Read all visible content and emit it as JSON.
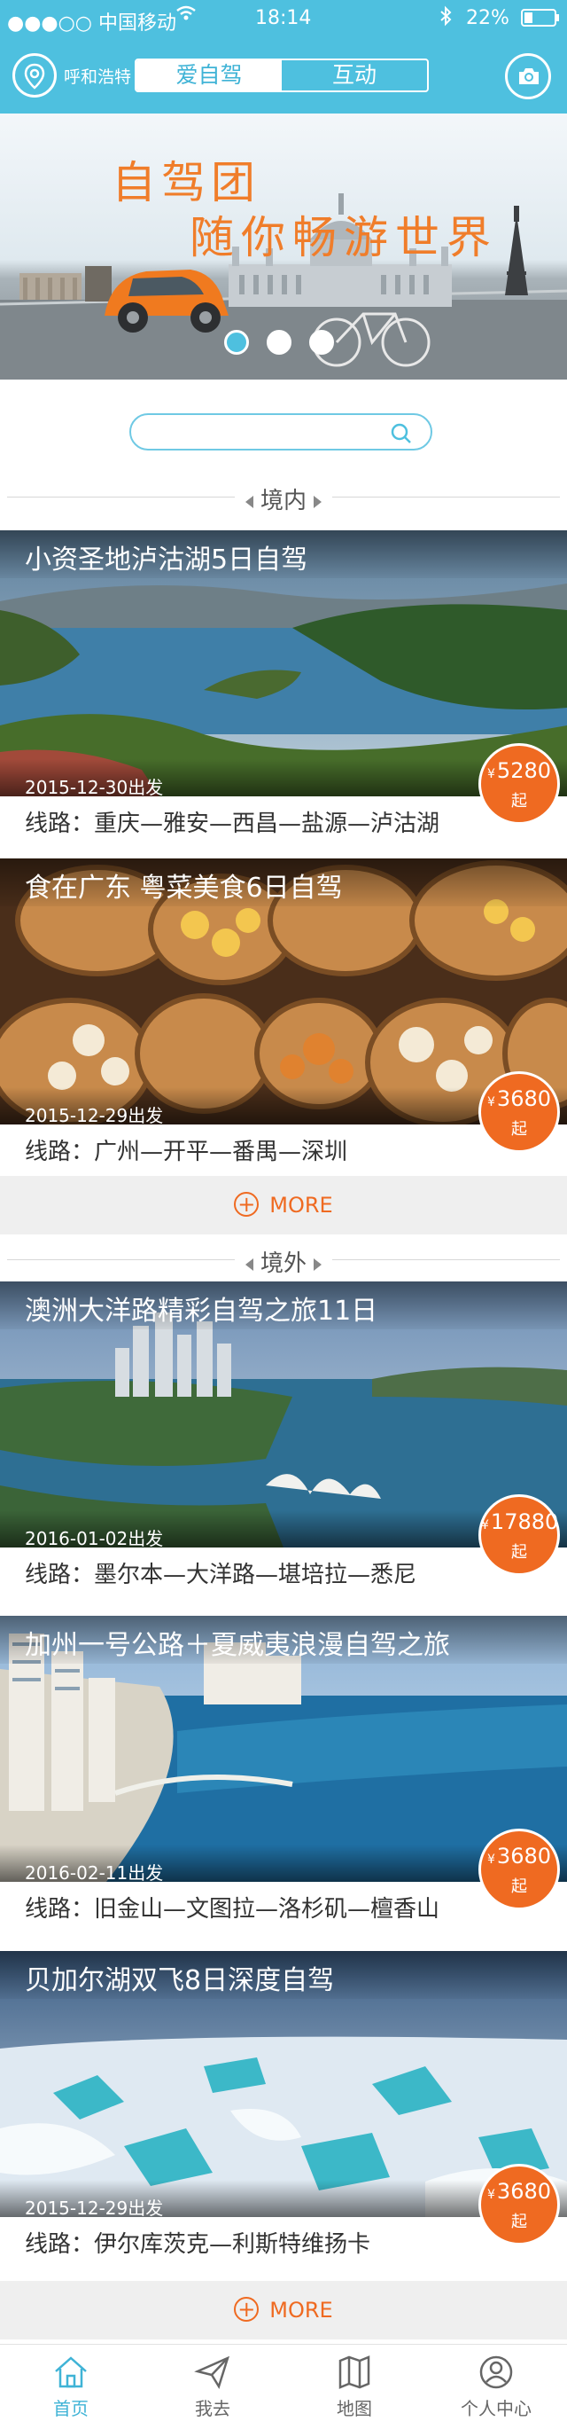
{
  "status": {
    "carrier": "●●●○○ 中国移动",
    "time": "18:14",
    "battery": "22%"
  },
  "nav": {
    "city": "呼和浩特",
    "tabs": [
      "爱自驾",
      "互动"
    ],
    "active_tab": 0
  },
  "banner": {
    "line1": "自驾团",
    "line2": "随你畅游世界"
  },
  "search": {
    "placeholder": ""
  },
  "sections": {
    "domestic": "境内",
    "overseas": "境外"
  },
  "more_label": "MORE",
  "price_currency": "¥",
  "price_unit": "起",
  "trips": [
    {
      "title": "小资圣地泸沽湖5日自驾",
      "date": "2015-12-30出发",
      "route": "线路：重庆—雅安—西昌—盐源—泸沽湖",
      "price": "5280"
    },
    {
      "title": "食在广东 粤菜美食6日自驾",
      "date": "2015-12-29出发",
      "route": "线路：广州—开平—番禺—深圳",
      "price": "3680"
    },
    {
      "title": "澳洲大洋路精彩自驾之旅11日",
      "date": "2016-01-02出发",
      "route": "线路：墨尔本—大洋路—堪培拉—悉尼",
      "price": "17880"
    },
    {
      "title": "加州一号公路＋夏威夷浪漫自驾之旅",
      "date": "2016-02-11出发",
      "route": "线路：旧金山—文图拉—洛杉矶—檀香山",
      "price": "3680"
    },
    {
      "title": "贝加尔湖双飞8日深度自驾",
      "date": "2015-12-29出发",
      "route": "线路：伊尔库茨克—利斯特维扬卡",
      "price": "3680"
    }
  ],
  "tabbar": [
    {
      "label": "首页",
      "icon": "home-icon"
    },
    {
      "label": "我去",
      "icon": "paper-plane-icon"
    },
    {
      "label": "地图",
      "icon": "map-icon"
    },
    {
      "label": "个人中心",
      "icon": "user-icon"
    }
  ],
  "colors": {
    "accent": "#4ec0df",
    "price": "#ef6a21"
  }
}
